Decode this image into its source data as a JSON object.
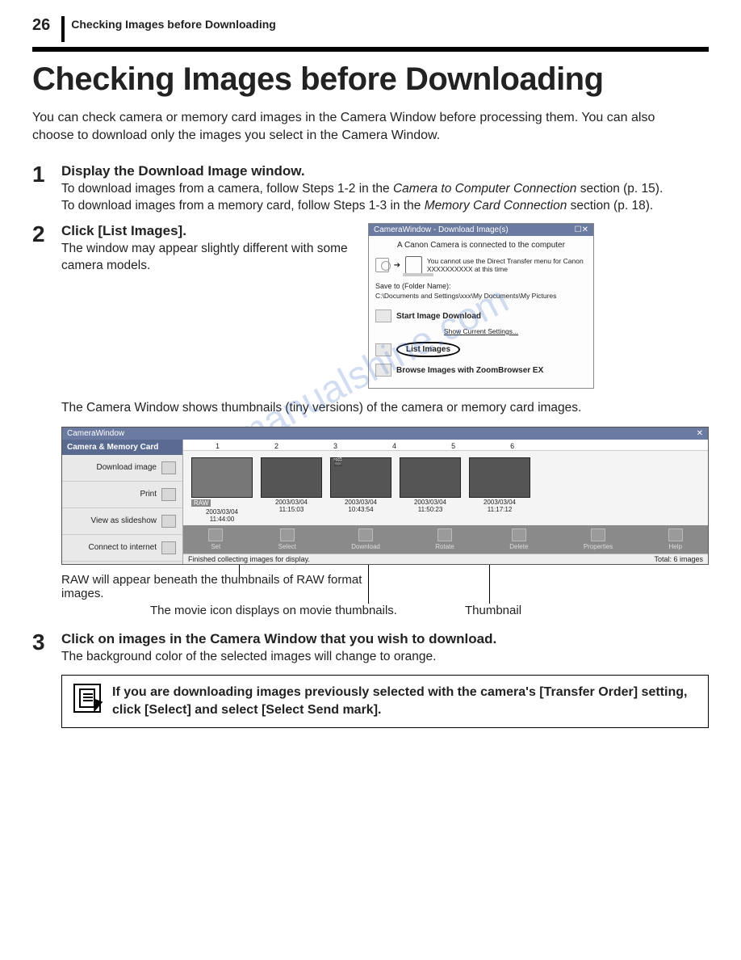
{
  "page_number": "26",
  "running_head": "Checking Images before Downloading",
  "title": "Checking Images before Downloading",
  "intro": "You can check camera or memory card images in the Camera Window before processing them. You can also choose to download only the images you select in the Camera Window.",
  "steps": {
    "s1": {
      "num": "1",
      "title": "Display the Download Image window.",
      "body_a": "To download images from a camera, follow Steps 1-2 in the ",
      "body_a_em": "Camera to Computer Connection",
      "body_a_tail": " section (p. 15).",
      "body_b": "To download images from a memory card, follow Steps 1-3 in the ",
      "body_b_em": "Memory Card Connection",
      "body_b_tail": " section (p. 18)."
    },
    "s2": {
      "num": "2",
      "title": "Click [List Images].",
      "body": "The window may appear slightly different with some camera models."
    },
    "s3": {
      "num": "3",
      "title": "Click on images in the Camera Window that you wish to download.",
      "body": "The background color of the selected images will change to orange."
    }
  },
  "cw_dialog": {
    "titlebar": "CameraWindow - Download Image(s)",
    "connected": "A Canon Camera is connected to the computer",
    "transfer_text": "You cannot use the Direct Transfer menu for Canon XXXXXXXXXX at this time",
    "saveto_label": "Save to (Folder Name):",
    "saveto_path": "C:\\Documents and Settings\\xxx\\My Documents\\My Pictures",
    "action_download": "Start Image Download",
    "show_settings": "Show Current Settings...",
    "action_list": "List Images",
    "action_browse": "Browse Images with ZoomBrowser EX"
  },
  "after_fig": "The Camera Window shows thumbnails (tiny versions) of the camera or memory card images.",
  "thumb_window": {
    "titlebar": "CameraWindow",
    "tab": "Camera & Memory Card",
    "sidebar": [
      "Download image",
      "Print",
      "View as slideshow",
      "Connect to internet"
    ],
    "ruler": [
      "1",
      "2",
      "3",
      "4",
      "5",
      "6"
    ],
    "thumbs": [
      {
        "date": "2003/03/04",
        "time": "11:44:00",
        "raw": true
      },
      {
        "date": "2003/03/04",
        "time": "11:15:03",
        "raw": false
      },
      {
        "date": "2003/03/04",
        "time": "10:43:54",
        "raw": false,
        "movie": true
      },
      {
        "date": "2003/03/04",
        "time": "11:50:23",
        "raw": false
      },
      {
        "date": "2003/03/04",
        "time": "11:17:12",
        "raw": false
      }
    ],
    "raw_badge": "RAW",
    "toolbar": [
      "Set",
      "Select",
      "Download",
      "Rotate",
      "Delete",
      "Properties",
      "Help"
    ],
    "status_left": "Finished collecting images for display.",
    "status_right": "Total: 6 images"
  },
  "annotations": {
    "raw": "RAW will appear beneath the thumbnails of RAW format images.",
    "movie": "The movie icon displays on movie thumbnails.",
    "thumb": "Thumbnail"
  },
  "note": "If you are downloading images previously selected with the camera's [Transfer Order] setting, click [Select] and select [Select Send mark].",
  "watermark": "manualshine.com"
}
